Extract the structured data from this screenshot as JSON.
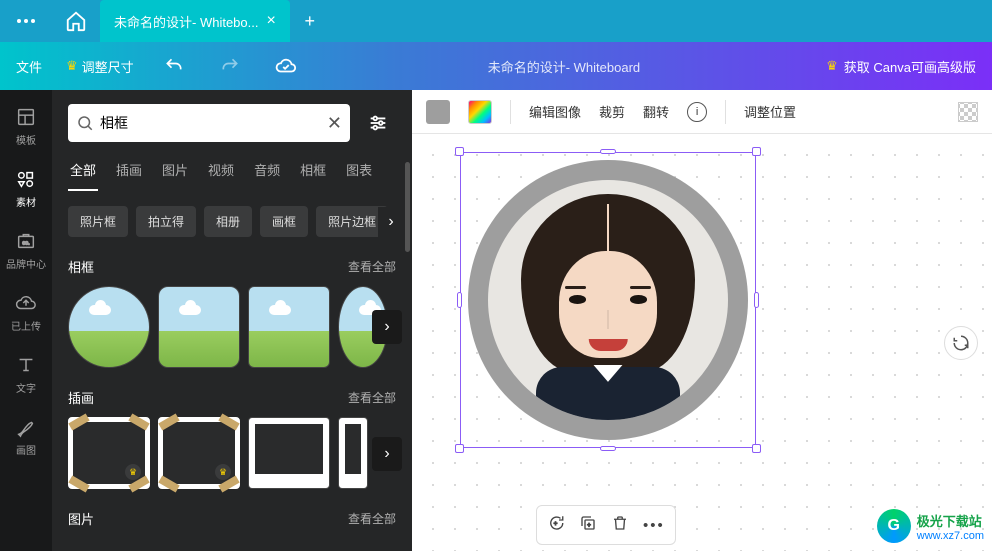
{
  "tabs": {
    "active_title": "未命名的设计- Whitebo...",
    "close": "×",
    "add": "+"
  },
  "menu": {
    "file": "文件",
    "resize": "调整尺寸",
    "doc_title": "未命名的设计- Whiteboard",
    "upgrade": "获取 Canva可画高级版"
  },
  "rail": {
    "templates": "模板",
    "elements": "素材",
    "brand": "品牌中心",
    "uploads": "已上传",
    "text": "文字",
    "draw": "画图"
  },
  "panel": {
    "search_value": "相框",
    "search_placeholder": "搜索",
    "cats": {
      "all": "全部",
      "illus": "插画",
      "photo": "图片",
      "video": "视频",
      "audio": "音频",
      "frame": "相框",
      "chart": "图表"
    },
    "chips": {
      "c1": "照片框",
      "c2": "拍立得",
      "c3": "相册",
      "c4": "画框",
      "c5": "照片边框"
    },
    "sec1_title": "相框",
    "sec2_title": "插画",
    "sec3_title": "图片",
    "see_all": "查看全部"
  },
  "toolbar": {
    "edit_image": "编辑图像",
    "crop": "裁剪",
    "flip": "翻转",
    "position": "调整位置"
  },
  "watermark": {
    "name": "极光下载站",
    "url": "www.xz7.com"
  }
}
